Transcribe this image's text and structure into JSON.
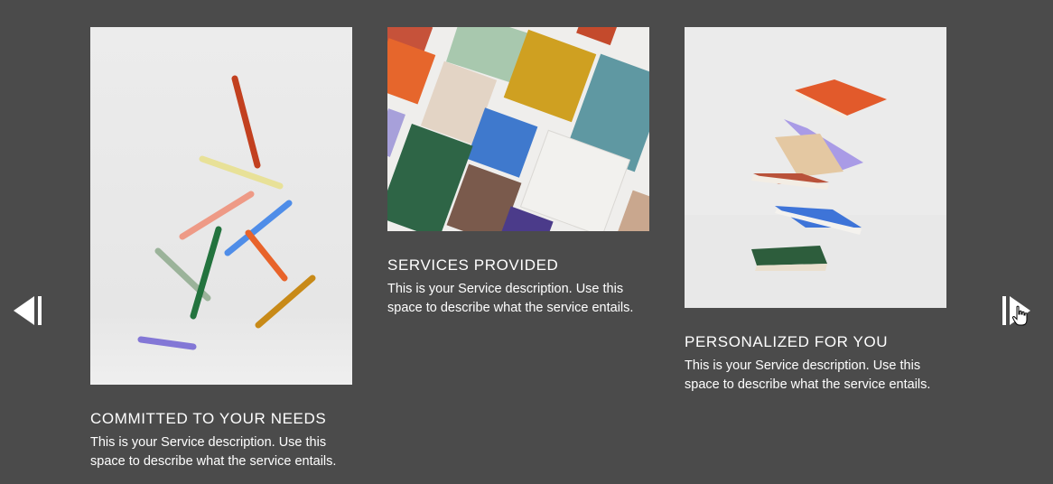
{
  "carousel": {
    "prev_label": "Previous",
    "next_label": "Next",
    "cards": [
      {
        "title": "COMMITTED TO YOUR NEEDS",
        "description": "This is your Service description. Use this space to describe what the service entails.",
        "image_alt": "Colorful pens falling"
      },
      {
        "title": "SERVICES PROVIDED",
        "description": "This is your Service description. Use this space to describe what the service entails.",
        "image_alt": "Colorful notebooks arranged diagonally"
      },
      {
        "title": "PERSONALIZED FOR YOU",
        "description": "This is your Service description. Use this space to describe what the service entails.",
        "image_alt": "Stack of floating notebooks"
      }
    ]
  },
  "colors": {
    "background": "#4b4b4b",
    "text": "#ffffff"
  }
}
